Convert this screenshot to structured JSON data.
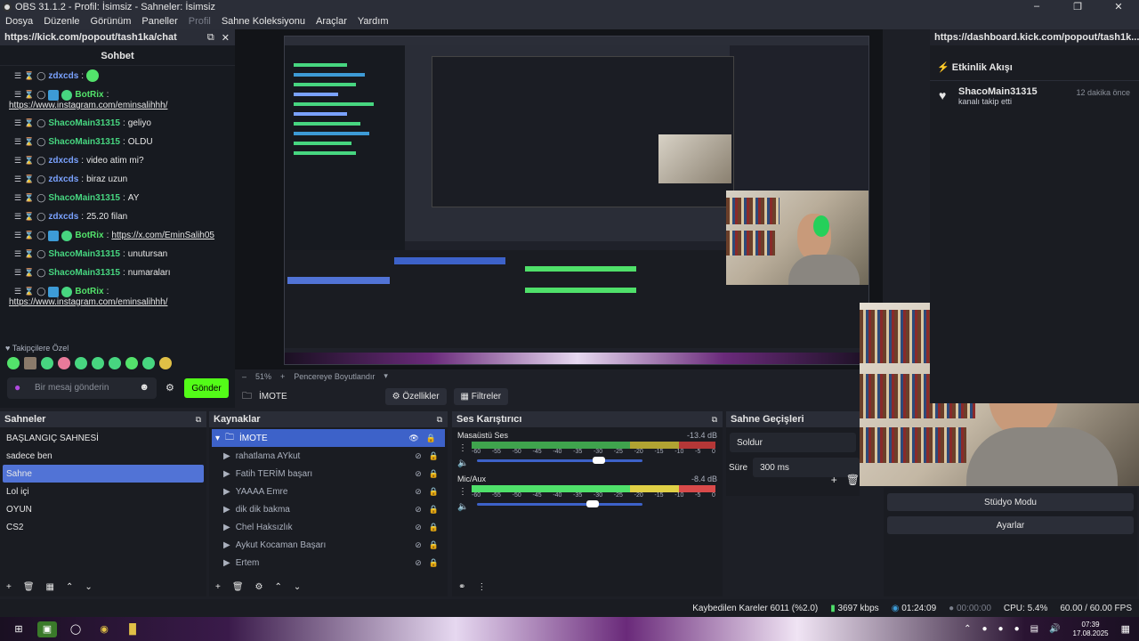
{
  "window": {
    "title": "OBS 31.1.2 - Profil: İsimsiz - Sahneler: İsimsiz"
  },
  "menu": [
    "Dosya",
    "Düzenle",
    "Görünüm",
    "Paneller",
    "Profil",
    "Sahne Koleksiyonu",
    "Araçlar",
    "Yardım"
  ],
  "chat_dock": {
    "url": "https://kick.com/popout/tash1ka/chat",
    "title": "Sohbet",
    "messages": [
      {
        "user": "zdxcds",
        "text": ""
      },
      {
        "user": "BotRix",
        "text": "",
        "link": "https://www.instagram.com/eminsalihhh/"
      },
      {
        "user": "ShacoMain31315",
        "text": "geliyo"
      },
      {
        "user": "ShacoMain31315",
        "text": "OLDU"
      },
      {
        "user": "zdxcds",
        "text": "video atim mi?"
      },
      {
        "user": "zdxcds",
        "text": "biraz uzun"
      },
      {
        "user": "ShacoMain31315",
        "text": "AY"
      },
      {
        "user": "zdxcds",
        "text": "25.20 filan"
      },
      {
        "user": "BotRix",
        "text": "",
        "link": "https://x.com/EminSalih05"
      },
      {
        "user": "ShacoMain31315",
        "text": "unutursan"
      },
      {
        "user": "ShacoMain31315",
        "text": "numaraları"
      },
      {
        "user": "BotRix",
        "text": "",
        "link": "https://www.instagram.com/eminsalihhh/"
      }
    ],
    "follower_special": "Takipçilere Özel",
    "input_placeholder": "Bir mesaj gönderin",
    "send_label": "Gönder"
  },
  "preview_toolbar": {
    "zoom": "51%",
    "fit": "Pencereye Boyutlandır"
  },
  "context_bar": {
    "source": "İMOTE",
    "properties": "Özellikler",
    "filters": "Filtreler"
  },
  "event_dock": {
    "url": "https://dashboard.kick.com/popout/tash1k...",
    "title": "Etkinlik Akışı",
    "event": {
      "user": "ShacoMain31315",
      "text": "kanalı takip etti",
      "time": "12 dakika önce"
    }
  },
  "scenes": {
    "title": "Sahneler",
    "items": [
      "BAŞLANGIÇ SAHNESİ",
      "sadece ben",
      "Sahne",
      "Lol içi",
      "OYUN",
      "CS2"
    ],
    "selected": "Sahne"
  },
  "sources": {
    "title": "Kaynaklar",
    "items": [
      "İMOTE",
      "rahatlama AYkut",
      "Fatih TERİM başarı",
      "YAAAA Emre",
      "dik dik bakma",
      "Chel Haksızlık",
      "Aykut Kocaman Başarı",
      "Ertem"
    ],
    "selected": "İMOTE"
  },
  "mixer": {
    "title": "Ses Karıştırıcı",
    "tracks": [
      {
        "name": "Masaüstü Ses",
        "db": "-13.4 dB",
        "level": 0.7
      },
      {
        "name": "Mic/Aux",
        "db": "-8.4 dB",
        "level": 0.66
      }
    ],
    "ticks": [
      "-60",
      "-55",
      "-50",
      "-45",
      "-40",
      "-35",
      "-30",
      "-25",
      "-20",
      "-15",
      "-10",
      "-5",
      "0"
    ]
  },
  "transitions": {
    "title": "Sahne Geçişleri",
    "type": "Soldur",
    "duration_label": "Süre",
    "duration": "300 ms"
  },
  "controls": {
    "studio_mode": "Stüdyo Modu",
    "settings": "Ayarlar"
  },
  "status": {
    "dropped": "Kaybedilen Kareler 6011 (%2.0)",
    "bitrate": "3697 kbps",
    "stream_time": "01:24:09",
    "rec_time": "00:00:00",
    "cpu": "CPU: 5.4%",
    "fps": "60.00 / 60.00 FPS"
  },
  "taskbar": {
    "time": "07:39",
    "date": "17.08.2025"
  }
}
